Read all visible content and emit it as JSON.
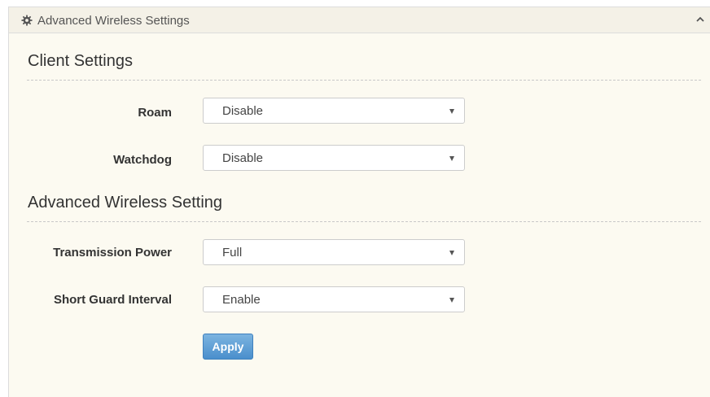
{
  "panel": {
    "title": "Advanced Wireless Settings",
    "icon": "gear-icon",
    "collapse_icon": "chevron-up-icon"
  },
  "client_settings": {
    "heading": "Client Settings",
    "roam": {
      "label": "Roam",
      "value": "Disable"
    },
    "watchdog": {
      "label": "Watchdog",
      "value": "Disable"
    }
  },
  "advanced_wireless_setting": {
    "heading": "Advanced Wireless Setting",
    "transmission_power": {
      "label": "Transmission Power",
      "value": "Full"
    },
    "short_guard_interval": {
      "label": "Short Guard Interval",
      "value": "Enable"
    }
  },
  "actions": {
    "apply_label": "Apply"
  },
  "colors": {
    "panel_background": "#fcfaf1",
    "button_blue": "#4a8fcc"
  }
}
